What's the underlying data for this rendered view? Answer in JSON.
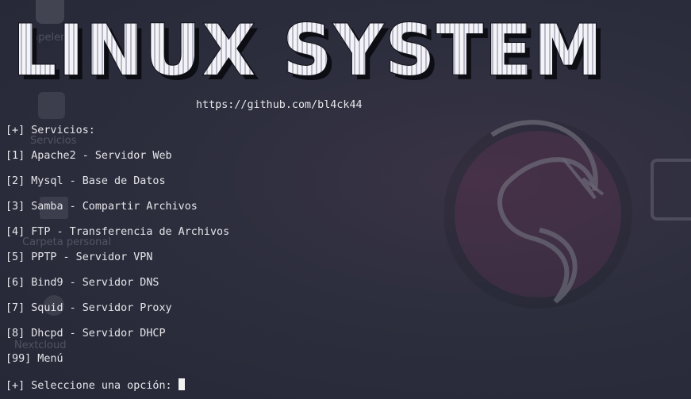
{
  "banner": {
    "title": "LINUX SYSTEM",
    "url": "https://github.com/bl4ck44"
  },
  "menu": {
    "header": "[+] Servicios:",
    "items": [
      "[1] Apache2 - Servidor Web",
      "[2] Mysql - Base de Datos",
      "[3] Samba - Compartir Archivos",
      "[4] FTP - Transferencia de Archivos",
      "[5] PPTP - Servidor VPN",
      "[6] Bind9 - Servidor DNS",
      "[7] Squid - Servidor Proxy",
      "[8] Dhcpd - Servidor DHCP",
      "[99] Menú"
    ],
    "prompt": "[+] Seleccione una opción:"
  },
  "colors": {
    "text": "#e6e6ea",
    "background": "#2a2d3c",
    "dragon_circle": "#8b2a5c"
  },
  "desktop_ghosts": {
    "labels": [
      "Papelera",
      "Servicios",
      "Carpeta personal",
      "Nextcloud"
    ],
    "icons": [
      "trash-icon",
      "power-icon",
      "home-folder-icon",
      "gear-icon",
      "kali-logo-icon"
    ]
  }
}
